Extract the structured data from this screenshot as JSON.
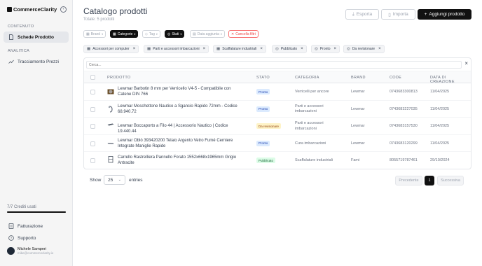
{
  "app": {
    "logo_text": "CommerceClarity"
  },
  "sidebar": {
    "section_content": "CONTENUTO",
    "section_analytics": "ANALITICA",
    "items": [
      {
        "label": "Schede Prodotto",
        "icon": "document-icon",
        "active": true
      },
      {
        "label": "Tracciamento Prezzi",
        "icon": "trend-icon",
        "active": false
      }
    ],
    "credits_label": "7/7 Crediti usati",
    "credits_fraction": 1.0,
    "bottom_links": [
      {
        "label": "Fatturazione",
        "icon": "billing-icon"
      },
      {
        "label": "Supporto",
        "icon": "help-icon"
      }
    ],
    "user": {
      "name": "Michele Samperi",
      "email": "mike@commerceclarity.io"
    }
  },
  "header": {
    "title": "Catalogo prodotti",
    "subtitle": "Totale: 5 prodotti",
    "export_label": "Esporta",
    "import_label": "Importa",
    "add_label": "Aggiungi prodotto"
  },
  "filters": {
    "brand": "Brand",
    "categorie": "Categorie",
    "tag": "Tag",
    "stati": "Stati",
    "data_aggiunta": "Data aggiunta",
    "cancella": "Cancella filtri"
  },
  "active_chips": [
    "Accessori per computer",
    "Parti e accessori imbarcazioni",
    "Scaffalature industriali",
    "Pubblicato",
    "Pronto",
    "Da revisionare"
  ],
  "table": {
    "search_placeholder": "Cerca...",
    "columns": [
      "PRODOTTO",
      "STATO",
      "CATEGORIA",
      "BRAND",
      "CODE",
      "DATA DI CREAZIONE"
    ],
    "rows": [
      {
        "name": "Lewmar Barbotin 8 mm per Verricello V4-5 - Compatibile con Catene DIN 766",
        "status": "Pronto",
        "status_kind": "pronto",
        "category": "Verricelli per ancore",
        "brand": "Lewmar",
        "code": "0743683300813",
        "date": "11/04/2025"
      },
      {
        "name": "Lewmar Moschettone Nautico a Sgancio Rapido 72mm - Codice 68.940.72",
        "status": "Pronto",
        "status_kind": "pronto",
        "category": "Parti e accessori imbarcazioni",
        "brand": "Lewmar",
        "code": "0743683227035",
        "date": "11/04/2025"
      },
      {
        "name": "Lewmar Boccaporto a Filo 44 | Accessorio Nautico | Codice 19.440.44",
        "status": "Da revisionare",
        "status_kind": "rev",
        "category": "Parti e accessori imbarcazioni",
        "brand": "Lewmar",
        "code": "0743683157530",
        "date": "11/04/2025"
      },
      {
        "name": "Lewmar Oblò 393420200 Telaio Argento Vetro Fumé Cerniere Integrate Maniglie Rapide",
        "status": "Pronto",
        "status_kind": "pronto",
        "category": "Cura imbarcazioni",
        "brand": "Lewmar",
        "code": "0743683120299",
        "date": "11/04/2025"
      },
      {
        "name": "Carrello Rastrelliera Pannello Forato 1552x668x1965mm Grigio Antracite",
        "status": "Pubblicato",
        "status_kind": "pub",
        "category": "Scaffalature industriali",
        "brand": "Fami",
        "code": "8055719787461",
        "date": "29/10/2024"
      }
    ]
  },
  "footer": {
    "show_label": "Show",
    "page_size": "25",
    "entries_label": "entries",
    "prev_label": "Precedente",
    "page": "1",
    "next_label": "Successiva"
  }
}
